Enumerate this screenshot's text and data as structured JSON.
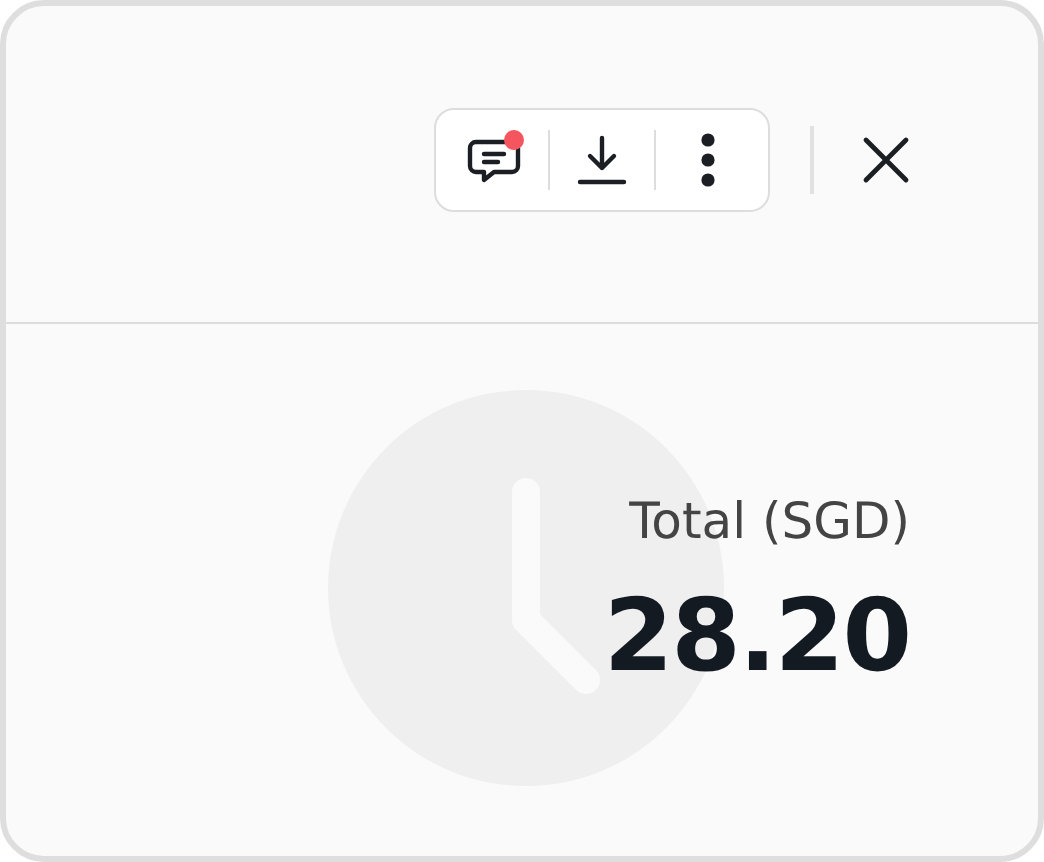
{
  "toolbar": {
    "actions": [
      {
        "kind": "comment",
        "badge": true
      },
      {
        "kind": "download",
        "badge": false
      },
      {
        "kind": "more",
        "badge": false
      }
    ]
  },
  "summary": {
    "label": "Total (SGD)",
    "amount": "28.20"
  }
}
